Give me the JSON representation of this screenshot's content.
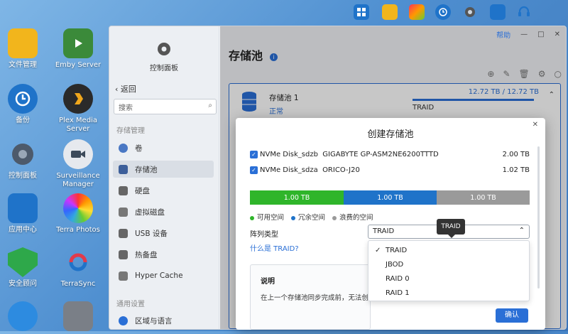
{
  "taskbar": {
    "icons": [
      "grid-icon",
      "folder-icon",
      "photos-icon",
      "backup-icon",
      "settings-icon",
      "app-center-icon",
      "support-icon"
    ]
  },
  "desktop": {
    "apps_left": [
      {
        "label": "文件管理",
        "icon": "folder-icon"
      },
      {
        "label": "备份",
        "icon": "backup-icon"
      },
      {
        "label": "控制面板",
        "icon": "gear-icon"
      },
      {
        "label": "应用中心",
        "icon": "app-center-icon"
      },
      {
        "label": "安全顾问",
        "icon": "security-icon"
      },
      {
        "label": "",
        "icon": "cloud-icon"
      }
    ],
    "apps_right": [
      {
        "label": "Emby Server",
        "icon": "emby-icon"
      },
      {
        "label": "Plex Media Server",
        "icon": "plex-icon"
      },
      {
        "label": "Surveillance Manager",
        "icon": "camera-icon"
      },
      {
        "label": "Terra Photos",
        "icon": "flower-icon"
      },
      {
        "label": "TerraSync",
        "icon": "sync-icon"
      },
      {
        "label": "",
        "icon": "media-icon"
      }
    ]
  },
  "window": {
    "help": "帮助",
    "controls": [
      "—",
      "□",
      "✕"
    ]
  },
  "sidebar": {
    "header": "控制面板",
    "back": "返回",
    "search_placeholder": "搜索",
    "section1": "存储管理",
    "items": [
      {
        "label": "卷",
        "color": "#4a78c4"
      },
      {
        "label": "存储池",
        "color": "#3d5f9a"
      },
      {
        "label": "硬盘",
        "color": "#666"
      },
      {
        "label": "虚拟磁盘",
        "color": "#777"
      },
      {
        "label": "USB 设备",
        "color": "#666"
      },
      {
        "label": "热备盘",
        "color": "#666"
      },
      {
        "label": "Hyper Cache",
        "color": "#777"
      }
    ],
    "section2": "通用设置",
    "items2": [
      {
        "label": "区域与语言",
        "color": "#2a6fd6"
      }
    ]
  },
  "content": {
    "title": "存储池",
    "pool": {
      "name": "存储池 1",
      "status": "正常",
      "capacity": "12.72 TB / 12.72 TB",
      "raid": "TRAID"
    }
  },
  "dialog": {
    "title": "创建存储池",
    "disks": [
      {
        "name": "NVMe Disk_sdzb",
        "model": "GIGABYTE GP-ASM2NE6200TTTD",
        "size": "2.00 TB"
      },
      {
        "name": "NVMe Disk_sdza",
        "model": "ORICO-J20",
        "size": "1.02 TB"
      }
    ],
    "segments": [
      {
        "label": "1.00 TB",
        "color": "#2fb52a"
      },
      {
        "label": "1.00 TB",
        "color": "#1f73c9"
      },
      {
        "label": "1.00 TB",
        "color": "#9a9a9a"
      }
    ],
    "legend": [
      {
        "label": "可用空间",
        "color": "#2fb52a"
      },
      {
        "label": "冗余空间",
        "color": "#1f73c9"
      },
      {
        "label": "浪费的空间",
        "color": "#9a9a9a"
      }
    ],
    "array_label": "阵列类型",
    "array_value": "TRAID",
    "tooltip": "TRAID",
    "what_link": "什么是 TRAID?",
    "note_title": "说明",
    "note_body": "在上一个存储池同步完成前，无法创",
    "options": [
      "TRAID",
      "JBOD",
      "RAID 0",
      "RAID 1"
    ],
    "selected": "TRAID",
    "ok": "确认"
  }
}
